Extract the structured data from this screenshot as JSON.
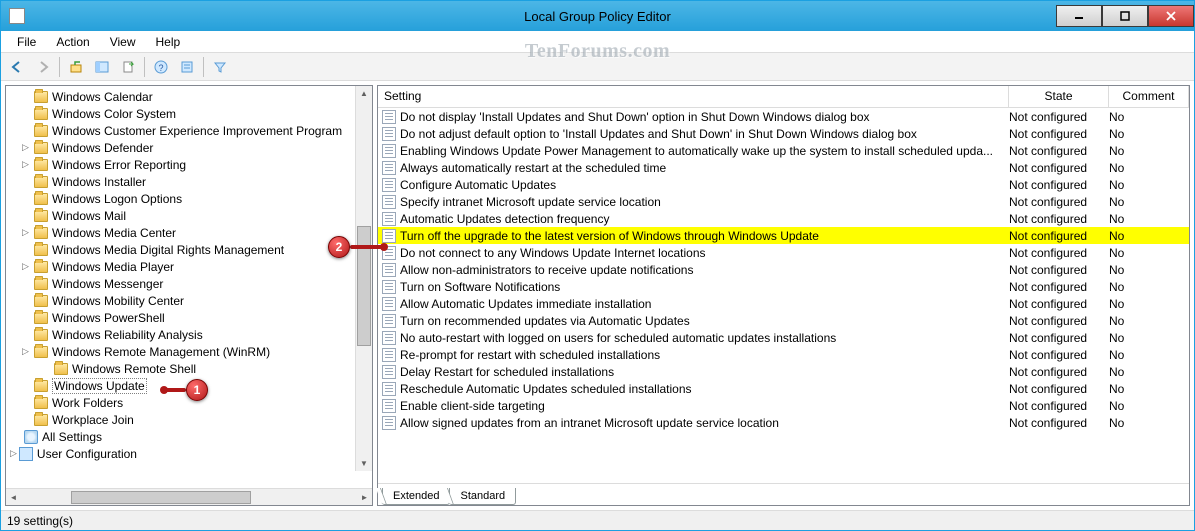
{
  "window": {
    "title": "Local Group Policy Editor"
  },
  "menubar": {
    "items": [
      "File",
      "Action",
      "View",
      "Help"
    ]
  },
  "watermark": "TenForums.com",
  "tree": {
    "root_label": "User Configuration",
    "all_settings": "All Settings",
    "items": [
      {
        "label": "Windows Calendar",
        "expander": ""
      },
      {
        "label": "Windows Color System",
        "expander": ""
      },
      {
        "label": "Windows Customer Experience Improvement Program",
        "expander": ""
      },
      {
        "label": "Windows Defender",
        "expander": "▷"
      },
      {
        "label": "Windows Error Reporting",
        "expander": "▷"
      },
      {
        "label": "Windows Installer",
        "expander": ""
      },
      {
        "label": "Windows Logon Options",
        "expander": ""
      },
      {
        "label": "Windows Mail",
        "expander": ""
      },
      {
        "label": "Windows Media Center",
        "expander": "▷"
      },
      {
        "label": "Windows Media Digital Rights Management",
        "expander": ""
      },
      {
        "label": "Windows Media Player",
        "expander": "▷"
      },
      {
        "label": "Windows Messenger",
        "expander": ""
      },
      {
        "label": "Windows Mobility Center",
        "expander": ""
      },
      {
        "label": "Windows PowerShell",
        "expander": ""
      },
      {
        "label": "Windows Reliability Analysis",
        "expander": ""
      },
      {
        "label": "Windows Remote Management (WinRM)",
        "expander": "▷"
      },
      {
        "label": "Windows Remote Shell",
        "expander": "",
        "child": true
      },
      {
        "label": "Windows Update",
        "expander": "",
        "selected": true
      },
      {
        "label": "Work Folders",
        "expander": ""
      },
      {
        "label": "Workplace Join",
        "expander": ""
      }
    ]
  },
  "columns": {
    "setting": "Setting",
    "state": "State",
    "comment": "Comment"
  },
  "settings": [
    {
      "name": "Do not display 'Install Updates and Shut Down' option in Shut Down Windows dialog box",
      "state": "Not configured",
      "comment": "No"
    },
    {
      "name": "Do not adjust default option to 'Install Updates and Shut Down' in Shut Down Windows dialog box",
      "state": "Not configured",
      "comment": "No"
    },
    {
      "name": "Enabling Windows Update Power Management to automatically wake up the system to install scheduled upda...",
      "state": "Not configured",
      "comment": "No"
    },
    {
      "name": "Always automatically restart at the scheduled time",
      "state": "Not configured",
      "comment": "No"
    },
    {
      "name": "Configure Automatic Updates",
      "state": "Not configured",
      "comment": "No"
    },
    {
      "name": "Specify intranet Microsoft update service location",
      "state": "Not configured",
      "comment": "No"
    },
    {
      "name": "Automatic Updates detection frequency",
      "state": "Not configured",
      "comment": "No"
    },
    {
      "name": "Turn off the upgrade to the latest version of Windows through Windows Update",
      "state": "Not configured",
      "comment": "No",
      "hl": true
    },
    {
      "name": "Do not connect to any Windows Update Internet locations",
      "state": "Not configured",
      "comment": "No"
    },
    {
      "name": "Allow non-administrators to receive update notifications",
      "state": "Not configured",
      "comment": "No"
    },
    {
      "name": "Turn on Software Notifications",
      "state": "Not configured",
      "comment": "No"
    },
    {
      "name": "Allow Automatic Updates immediate installation",
      "state": "Not configured",
      "comment": "No"
    },
    {
      "name": "Turn on recommended updates via Automatic Updates",
      "state": "Not configured",
      "comment": "No"
    },
    {
      "name": "No auto-restart with logged on users for scheduled automatic updates installations",
      "state": "Not configured",
      "comment": "No"
    },
    {
      "name": "Re-prompt for restart with scheduled installations",
      "state": "Not configured",
      "comment": "No"
    },
    {
      "name": "Delay Restart for scheduled installations",
      "state": "Not configured",
      "comment": "No"
    },
    {
      "name": "Reschedule Automatic Updates scheduled installations",
      "state": "Not configured",
      "comment": "No"
    },
    {
      "name": "Enable client-side targeting",
      "state": "Not configured",
      "comment": "No"
    },
    {
      "name": "Allow signed updates from an intranet Microsoft update service location",
      "state": "Not configured",
      "comment": "No"
    }
  ],
  "tabs": {
    "extended": "Extended",
    "standard": "Standard"
  },
  "status": "19 setting(s)",
  "annotations": {
    "a1": "1",
    "a2": "2"
  }
}
